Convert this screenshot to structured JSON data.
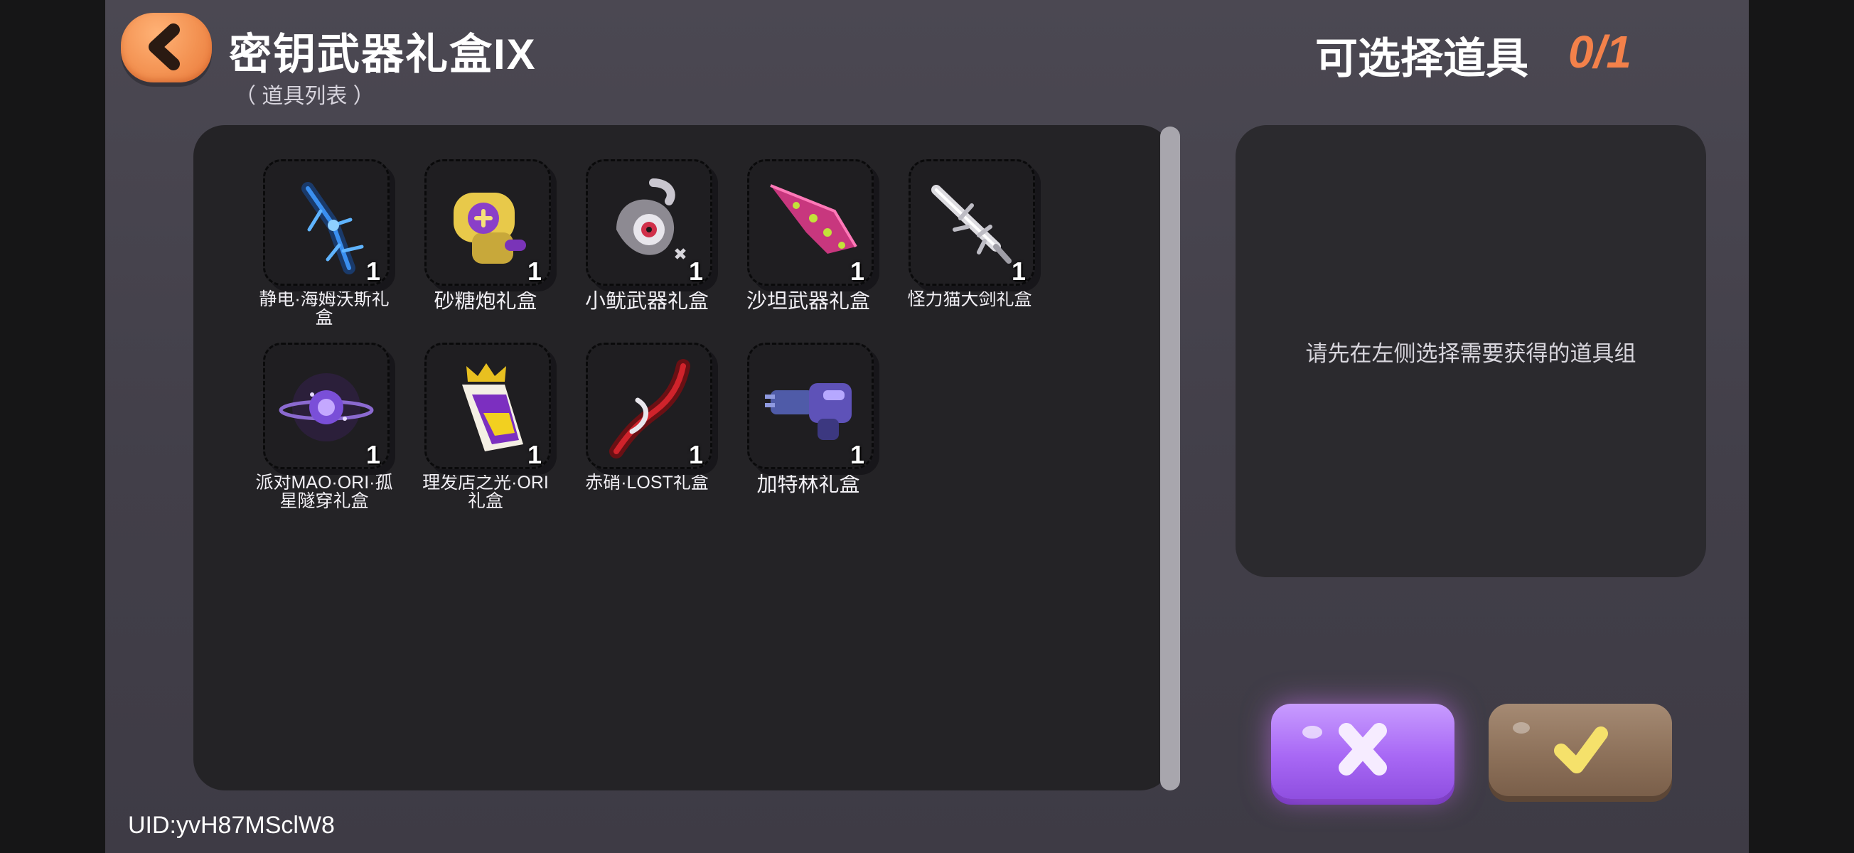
{
  "header": {
    "back_icon": "chevron-left-icon",
    "title": "密钥武器礼盒IX",
    "subtitle": "（ 道具列表 ）",
    "selectable_label": "可选择道具",
    "selectable_count": "0/1"
  },
  "items": [
    {
      "name": "静电·海姆沃斯礼盒",
      "qty": "1",
      "icon": "electric-blue-trident-icon"
    },
    {
      "name": "砂糖炮礼盒",
      "qty": "1",
      "icon": "yellow-purple-cannon-icon"
    },
    {
      "name": "小鱿武器礼盒",
      "qty": "1",
      "icon": "squid-weapon-icon"
    },
    {
      "name": "沙坦武器礼盒",
      "qty": "1",
      "icon": "pink-spotted-blade-icon"
    },
    {
      "name": "怪力猫大剑礼盒",
      "qty": "1",
      "icon": "silver-greatsword-icon"
    },
    {
      "name": "派对MAO·ORI·孤星隧穿礼盒",
      "qty": "1",
      "icon": "purple-orb-icon"
    },
    {
      "name": "理发店之光·ORI礼盒",
      "qty": "1",
      "icon": "crowned-prism-icon"
    },
    {
      "name": "赤硝·LOST礼盒",
      "qty": "1",
      "icon": "red-curved-blade-icon"
    },
    {
      "name": "加特林礼盒",
      "qty": "1",
      "icon": "gatling-gun-icon"
    }
  ],
  "detail": {
    "hint": "请先在左侧选择需要获得的道具组"
  },
  "buttons": {
    "cancel_icon": "close-icon",
    "confirm_icon": "checkmark-icon"
  },
  "footer": {
    "uid": "UID:yvH87MSclW8"
  },
  "colors": {
    "accent_orange": "#f3814a",
    "cancel_purple": "#a868f5",
    "confirm_brown": "#8b6f58"
  }
}
